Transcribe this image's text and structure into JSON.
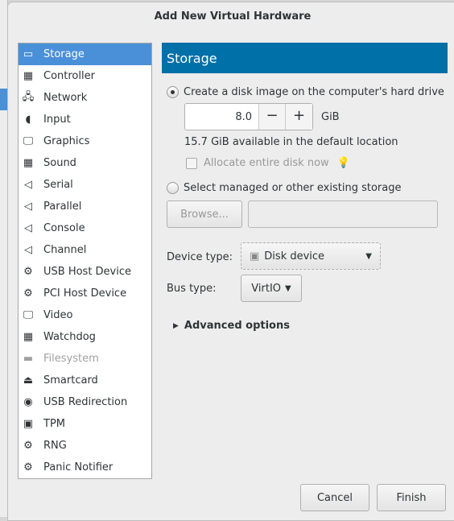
{
  "dialog": {
    "title": "Add New Virtual Hardware"
  },
  "list": [
    {
      "label": "Storage",
      "icon": "storage-icon",
      "g": "▭",
      "selected": true
    },
    {
      "label": "Controller",
      "icon": "controller-icon",
      "g": "▦"
    },
    {
      "label": "Network",
      "icon": "network-icon",
      "g": "🖧"
    },
    {
      "label": "Input",
      "icon": "mouse-icon",
      "g": "◖"
    },
    {
      "label": "Graphics",
      "icon": "monitor-icon",
      "g": "🖵"
    },
    {
      "label": "Sound",
      "icon": "sound-card-icon",
      "g": "▦"
    },
    {
      "label": "Serial",
      "icon": "serial-port-icon",
      "g": "◁"
    },
    {
      "label": "Parallel",
      "icon": "parallel-port-icon",
      "g": "◁"
    },
    {
      "label": "Console",
      "icon": "console-port-icon",
      "g": "◁"
    },
    {
      "label": "Channel",
      "icon": "channel-port-icon",
      "g": "◁"
    },
    {
      "label": "USB Host Device",
      "icon": "usb-host-device-icon",
      "g": "⚙"
    },
    {
      "label": "PCI Host Device",
      "icon": "pci-host-device-icon",
      "g": "⚙"
    },
    {
      "label": "Video",
      "icon": "video-icon",
      "g": "🖵"
    },
    {
      "label": "Watchdog",
      "icon": "watchdog-icon",
      "g": "▦"
    },
    {
      "label": "Filesystem",
      "icon": "folder-icon",
      "g": "▬",
      "disabled": true
    },
    {
      "label": "Smartcard",
      "icon": "smartcard-icon",
      "g": "⏏"
    },
    {
      "label": "USB Redirection",
      "icon": "usb-icon",
      "g": "◉"
    },
    {
      "label": "TPM",
      "icon": "chip-icon",
      "g": "▣"
    },
    {
      "label": "RNG",
      "icon": "gears-icon",
      "g": "⚙"
    },
    {
      "label": "Panic Notifier",
      "icon": "gears-icon",
      "g": "⚙"
    }
  ],
  "storage": {
    "header": "Storage",
    "create_label": "Create a disk image on the computer's hard drive",
    "size_value": "8.0",
    "minus": "−",
    "plus": "+",
    "unit": "GiB",
    "available": "15.7 GiB available in the default location",
    "allocate_label": "Allocate entire disk now",
    "select_label": "Select managed or other existing storage",
    "browse_label": "Browse...",
    "path_value": "",
    "device_type_label": "Device type:",
    "device_type_value": "Disk device",
    "bus_type_label": "Bus type:",
    "bus_type_value": "VirtIO",
    "advanced_label": "Advanced options"
  },
  "buttons": {
    "cancel": "Cancel",
    "finish": "Finish"
  },
  "colors": {
    "header": "#0070a8",
    "selection": "#4a90d9"
  }
}
